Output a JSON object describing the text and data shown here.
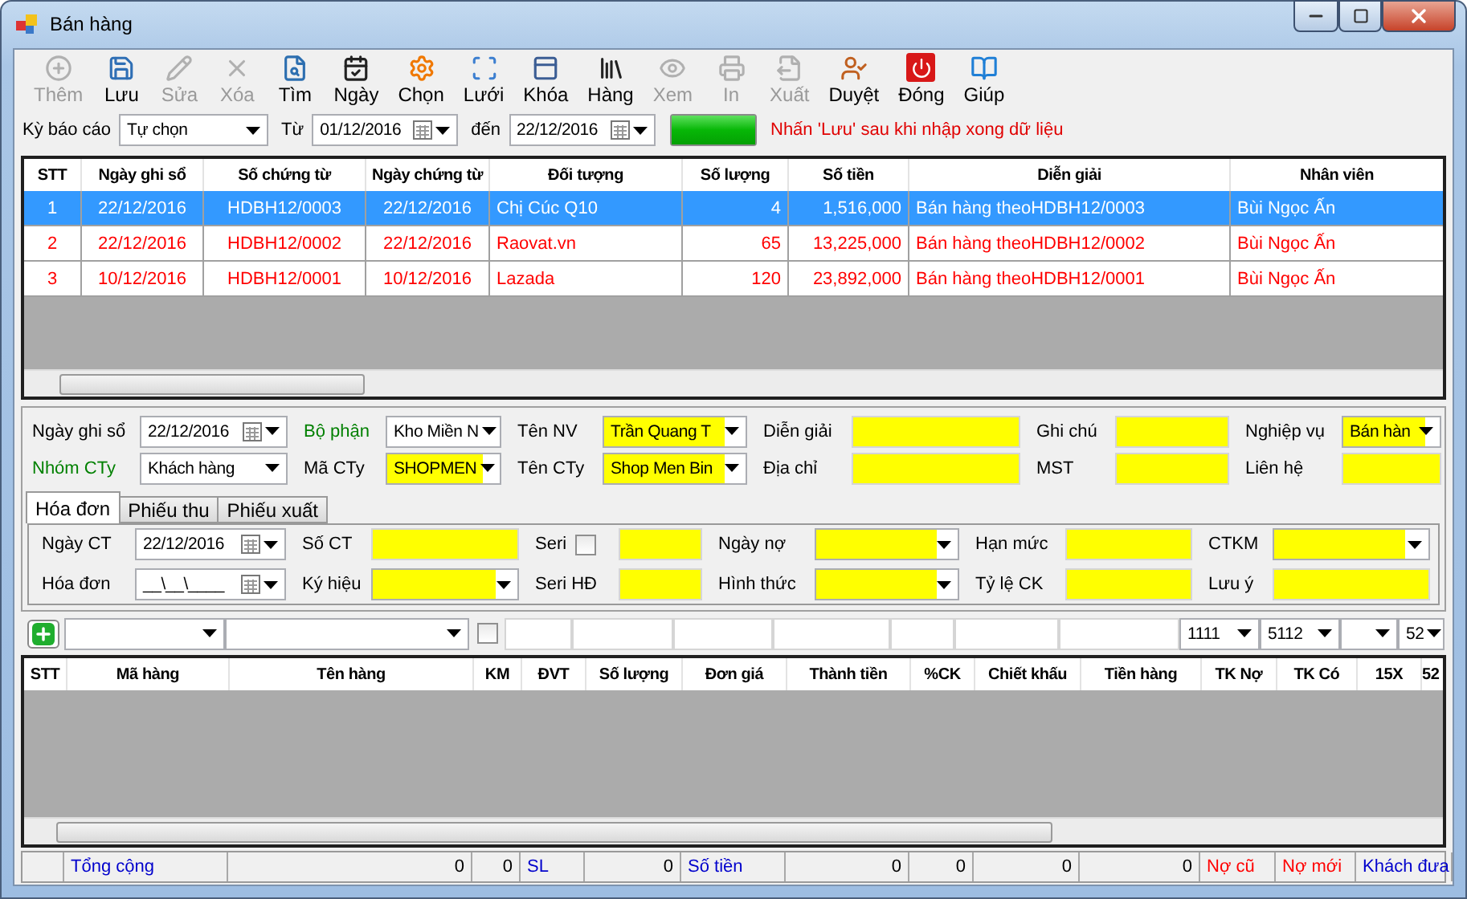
{
  "window": {
    "title": "Bán hàng"
  },
  "toolbar": [
    {
      "label": "Thêm",
      "disabled": true
    },
    {
      "label": "Lưu",
      "disabled": false
    },
    {
      "label": "Sửa",
      "disabled": true
    },
    {
      "label": "Xóa",
      "disabled": true
    },
    {
      "label": "Tìm",
      "disabled": false
    },
    {
      "label": "Ngày",
      "disabled": false
    },
    {
      "label": "Chọn",
      "disabled": false
    },
    {
      "label": "Lưới",
      "disabled": false
    },
    {
      "label": "Khóa",
      "disabled": false
    },
    {
      "label": "Hàng",
      "disabled": false
    },
    {
      "label": "Xem",
      "disabled": true
    },
    {
      "label": "In",
      "disabled": true
    },
    {
      "label": "Xuất",
      "disabled": true
    },
    {
      "label": "Duyệt",
      "disabled": false
    },
    {
      "label": "Đóng",
      "disabled": false
    },
    {
      "label": "Giúp",
      "disabled": false
    }
  ],
  "filter": {
    "period_label": "Kỳ báo cáo",
    "period": "Tự chọn",
    "from_label": "Từ",
    "from": "01/12/2016",
    "to_label": "đến",
    "to": "22/12/2016",
    "progress": {
      "level": 1
    },
    "hint": "Nhấn 'Lưu' sau khi nhập xong dữ liệu"
  },
  "voucher_table": {
    "columns": [
      "STT",
      "Ngày ghi sổ",
      "Số chứng từ",
      "Ngày chứng từ",
      "Đối tượng",
      "Số lượng",
      "Số tiền",
      "Diễn giải",
      "Nhân viên"
    ],
    "rows": [
      {
        "selected": true,
        "cells": [
          "1",
          "22/12/2016",
          "HDBH12/0003",
          "22/12/2016",
          "Chị Cúc Q10",
          "4",
          "1,516,000",
          "Bán hàng theoHDBH12/0003",
          "Bùi Ngọc Ấn"
        ]
      },
      {
        "selected": false,
        "cells": [
          "2",
          "22/12/2016",
          "HDBH12/0002",
          "22/12/2016",
          "Raovat.vn",
          "65",
          "13,225,000",
          "Bán hàng theoHDBH12/0002",
          "Bùi Ngọc Ấn"
        ]
      },
      {
        "selected": false,
        "cells": [
          "3",
          "10/12/2016",
          "HDBH12/0001",
          "10/12/2016",
          "Lazada",
          "120",
          "23,892,000",
          "Bán hàng theoHDBH12/0001",
          "Bùi Ngọc Ấn"
        ]
      }
    ]
  },
  "header_fields": [
    [
      {
        "label": "Ngày ghi sổ",
        "kind": "date",
        "value": "22/12/2016",
        "color": "#000000"
      },
      {
        "label": "Bộ phận",
        "kind": "combo",
        "value": "Kho Miền N",
        "highlighted": false,
        "color": "#008000"
      },
      {
        "label": "Tên NV",
        "kind": "combo",
        "value": "Trần Quang T",
        "highlighted": true,
        "color": "#000000"
      },
      {
        "label": "Diễn giải",
        "kind": "text",
        "highlighted": true,
        "color": "#000000"
      },
      {
        "label": "Ghi chú",
        "kind": "text",
        "highlighted": true,
        "color": "#000000"
      },
      {
        "label": "Nghiệp vụ",
        "kind": "combo",
        "value": "Bán hàn",
        "highlighted": true,
        "color": "#000000"
      }
    ],
    [
      {
        "label": "Nhóm CTy",
        "kind": "combo",
        "value": "Khách hàng",
        "highlighted": false,
        "color": "#008000"
      },
      {
        "label": "Mã CTy",
        "kind": "combo",
        "value": "SHOPMEN",
        "highlighted": true,
        "color": "#000000"
      },
      {
        "label": "Tên CTy",
        "kind": "combo",
        "value": "Shop Men Bin",
        "highlighted": true,
        "color": "#000000"
      },
      {
        "label": "Địa chỉ",
        "kind": "text",
        "highlighted": true,
        "color": "#000000"
      },
      {
        "label": "MST",
        "kind": "text",
        "highlighted": true,
        "color": "#000000"
      },
      {
        "label": "Liên hệ",
        "kind": "text",
        "highlighted": true,
        "color": "#000000"
      }
    ]
  ],
  "tabs": [
    {
      "label": "Hóa đơn",
      "selected": true
    },
    {
      "label": "Phiếu thu",
      "selected": false
    },
    {
      "label": "Phiếu xuất",
      "selected": false
    }
  ],
  "invoice_fields": [
    [
      {
        "label": "Ngày CT",
        "kind": "date",
        "value": "22/12/2016"
      },
      {
        "label": "Số CT",
        "kind": "text",
        "highlighted": true
      },
      {
        "label": "Seri",
        "kind": "check_text",
        "checked": false,
        "highlighted": true
      },
      {
        "label": "Ngày nợ",
        "kind": "combo",
        "highlighted": true
      },
      {
        "label": "Hạn mức",
        "kind": "text",
        "highlighted": true
      },
      {
        "label": "CTKM",
        "kind": "combo",
        "highlighted": true
      }
    ],
    [
      {
        "label": "Hóa đơn",
        "kind": "date",
        "value": "__\\__\\____"
      },
      {
        "label": "Ký hiệu",
        "kind": "combo",
        "highlighted": true
      },
      {
        "label": "Seri HĐ",
        "kind": "text",
        "highlighted": true
      },
      {
        "label": "Hình thức",
        "kind": "combo",
        "highlighted": true
      },
      {
        "label": "Tỷ lệ CK",
        "kind": "text",
        "highlighted": true
      },
      {
        "label": "Lưu ý",
        "kind": "text",
        "highlighted": true
      }
    ]
  ],
  "entry_row": [
    {
      "kind": "add"
    },
    {
      "kind": "combo"
    },
    {
      "kind": "combo"
    },
    {
      "kind": "check",
      "checked": false
    },
    {
      "kind": "text"
    },
    {
      "kind": "text"
    },
    {
      "kind": "text"
    },
    {
      "kind": "text"
    },
    {
      "kind": "text"
    },
    {
      "kind": "text"
    },
    {
      "kind": "text"
    },
    {
      "kind": "combo",
      "value": "1111"
    },
    {
      "kind": "combo",
      "value": "5112"
    },
    {
      "kind": "combo"
    },
    {
      "kind": "combo",
      "value": "52"
    }
  ],
  "item_table": {
    "columns": [
      "STT",
      "Mã hàng",
      "Tên hàng",
      "KM",
      "ĐVT",
      "Số lượng",
      "Đơn giá",
      "Thành tiền",
      "%CK",
      "Chiết khấu",
      "Tiền hàng",
      "TK Nợ",
      "TK Có",
      "15X",
      "52"
    ]
  },
  "totals": [
    {
      "text": "Tổng cộng",
      "color": "#0000cc"
    },
    {
      "text": "0",
      "color": "#000000"
    },
    {
      "text": "0",
      "color": "#000000"
    },
    {
      "text": "SL",
      "color": "#0000cc"
    },
    {
      "text": "0",
      "color": "#000000"
    },
    {
      "text": "Số tiền",
      "color": "#0000cc"
    },
    {
      "text": "0",
      "color": "#000000"
    },
    {
      "text": "0",
      "color": "#000000"
    },
    {
      "text": "0",
      "color": "#000000"
    },
    {
      "text": "0",
      "color": "#000000"
    },
    {
      "text": "Nợ cũ",
      "color": "#ff0000"
    },
    {
      "text": "Nợ mới",
      "color": "#ff0000"
    },
    {
      "text": "Khách đưa",
      "color": "#0000cc"
    }
  ]
}
